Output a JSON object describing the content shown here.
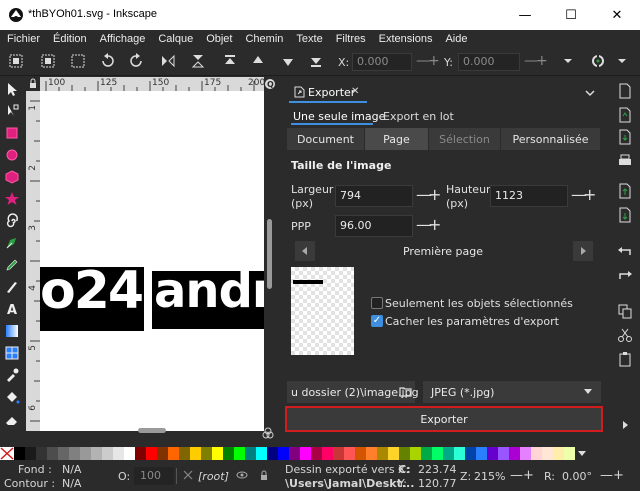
{
  "window": {
    "title": "*thBYOh01.svg - Inkscape",
    "minimize": "—",
    "maximize": "☐",
    "close": "✕"
  },
  "menu": [
    "Fichier",
    "Édition",
    "Affichage",
    "Calque",
    "Objet",
    "Chemin",
    "Texte",
    "Filtres",
    "Extensions",
    "Aide"
  ],
  "toolbar": {
    "x_label": "X:",
    "x_value": "0.000",
    "y_label": "Y:",
    "y_value": "0.000",
    "minus": "—",
    "plus": "+"
  },
  "rulers": {
    "h": [
      "100",
      "125",
      "150",
      "175",
      "200"
    ],
    "v": [
      "1",
      "2",
      "3",
      "4",
      "5",
      "6"
    ]
  },
  "canvas": {
    "text_left": "o24",
    "text_right": "andı"
  },
  "dock": {
    "tab_label": "Exporter",
    "tab_close": "✕",
    "subtabs": [
      "Une seule image",
      "Export en lot"
    ],
    "segments": [
      "Document",
      "Page",
      "Sélection",
      "Personnalisée"
    ],
    "section_title": "Taille de l'image",
    "width_label": "Largeur\n(px)",
    "width_value": "794",
    "height_label": "Hauteur\n(px)",
    "height_value": "1123",
    "dpi_label": "PPP",
    "dpi_value": "96.00",
    "minus": "—",
    "plus": "+",
    "page_name": "Première page",
    "only_selected_label": "Seulement les objets sélectionnés",
    "only_selected_checked": false,
    "hide_params_label": "Cacher les paramètres d'export",
    "hide_params_checked": true,
    "filename": "u dossier (2)\\image.jpg",
    "format": "JPEG (*.jpg)",
    "export_button": "Exporter"
  },
  "palette": [
    "#000000",
    "#1a1a1a",
    "#333333",
    "#4d4d4d",
    "#666666",
    "#808080",
    "#999999",
    "#b3b3b3",
    "#cccccc",
    "#e6e6e6",
    "#ffffff",
    "#800000",
    "#ff0000",
    "#803300",
    "#ff6600",
    "#806600",
    "#ffcc00",
    "#808000",
    "#ffff00",
    "#008000",
    "#00ff00",
    "#008080",
    "#00ffff",
    "#000080",
    "#0000ff",
    "#800080",
    "#ff00ff",
    "#aa0044",
    "#ff0066",
    "#c83737",
    "#ff5555",
    "#d45500",
    "#ff7f2a",
    "#aa8800",
    "#ffd42a",
    "#668000",
    "#aad400",
    "#00aa44",
    "#00ff66",
    "#00aa88",
    "#2affd5",
    "#0044aa",
    "#2a7fff",
    "#6600cc",
    "#9955ff",
    "#aa00d4",
    "#e580ff",
    "#ffd5d5",
    "#ffe6d5",
    "#ffeeaa",
    "#eeffaa"
  ],
  "status": {
    "fill_label": "Fond :",
    "fill_value": "N/A",
    "stroke_label": "Contour :",
    "stroke_value": "N/A",
    "opacity_label": "O:",
    "opacity_value": "100",
    "layer": "[root]",
    "message_line1": "Dessin exporté vers ",
    "message_drive": "C:",
    "message_line2": "\\Users\\Jamal\\Deskt...",
    "x_label": "X:",
    "x_value": "223.74",
    "y_label": "Y:",
    "y_value": "120.77",
    "zoom_label": "Z:",
    "zoom_value": "215%",
    "rotate_label": "R:",
    "rotate_value": "0.00°"
  },
  "colors": {
    "accent": "#3f8fe0",
    "export_highlight": "#d11d1d",
    "selected_green": "#2ea043"
  }
}
